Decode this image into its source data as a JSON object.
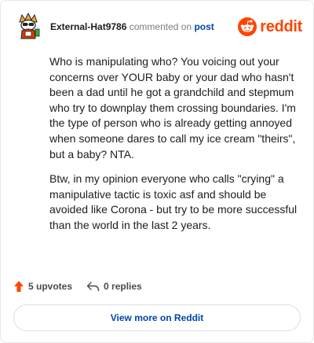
{
  "header": {
    "username": "External-Hat9786",
    "action_text": "commented on",
    "post_link": "post",
    "brand_name": "reddit"
  },
  "comment": {
    "paragraphs": [
      "Who is manipulating who? You voicing out your concerns over YOUR baby or your dad who hasn't been a dad until he got a grandchild and stepmum who try to downplay them crossing boundaries. I'm the type of person who is already getting annoyed when someone dares to call my ice cream \"theirs\", but a baby? NTA.",
      "Btw, in my opinion everyone who calls \"crying\" a manipulative tactic is toxic asf and should be avoided like Corona - but try to be more successful than the world in the last 2 years."
    ]
  },
  "actions": {
    "upvotes": "5 upvotes",
    "replies": "0 replies"
  },
  "footer": {
    "view_more": "View more on Reddit"
  },
  "colors": {
    "brand": "#ff4500",
    "link": "#0045ac"
  },
  "icons": {
    "avatar": "snoo-avatar-icon",
    "brand": "reddit-logo-icon",
    "upvote": "upvote-arrow-icon",
    "reply": "reply-arrow-icon"
  }
}
